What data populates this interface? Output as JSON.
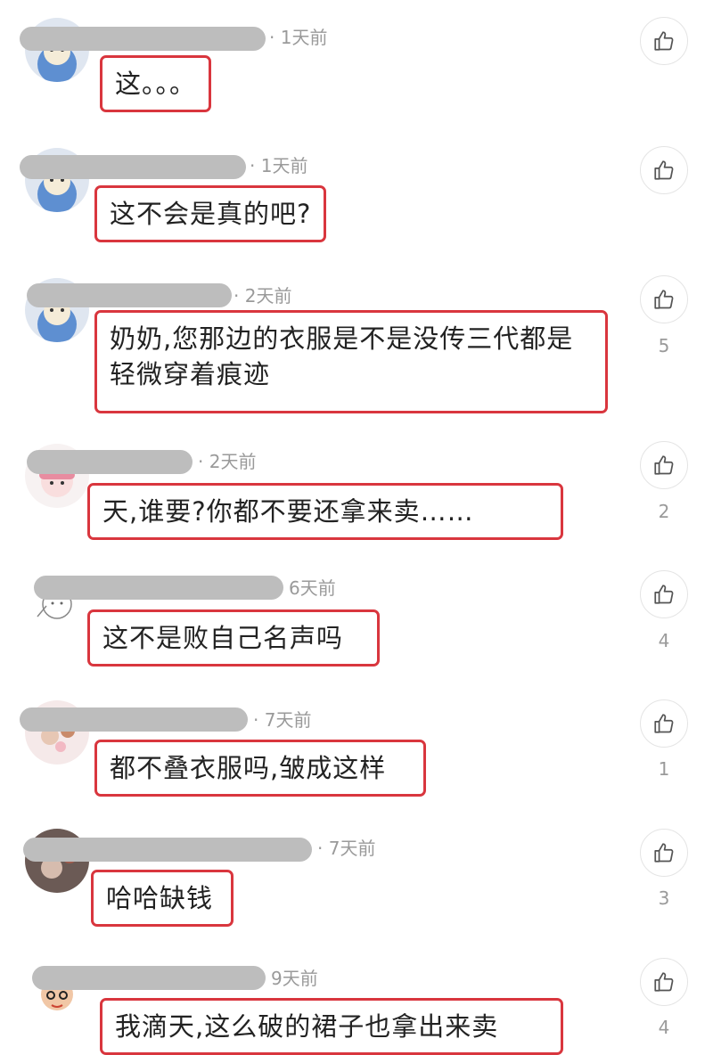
{
  "comments": [
    {
      "time": "1天前",
      "text": "这。。。",
      "likes": ""
    },
    {
      "time": "1天前",
      "text": "这不会是真的吧?",
      "likes": ""
    },
    {
      "time": "2天前",
      "text": "奶奶,您那边的衣服是不是没传三代都是轻微穿着痕迹",
      "likes": "5"
    },
    {
      "time": "2天前",
      "text": "天,谁要?你都不要还拿来卖……",
      "likes": "2"
    },
    {
      "time": "6天前",
      "text": "这不是败自己名声吗",
      "likes": "4"
    },
    {
      "time": "7天前",
      "text": "都不叠衣服吗,皱成这样",
      "likes": "1"
    },
    {
      "time": "7天前",
      "text": "哈哈缺钱",
      "likes": "3"
    },
    {
      "time": "9天前",
      "text": "我滴天,这么破的裙子也拿出来卖",
      "likes": "4"
    }
  ],
  "icons": {
    "like": "thumbs-up-icon",
    "avatar": "user-avatar"
  },
  "colors": {
    "highlight_border": "#d9363e",
    "meta_text": "#9a9a9a",
    "redaction": "#bdbdbd"
  }
}
